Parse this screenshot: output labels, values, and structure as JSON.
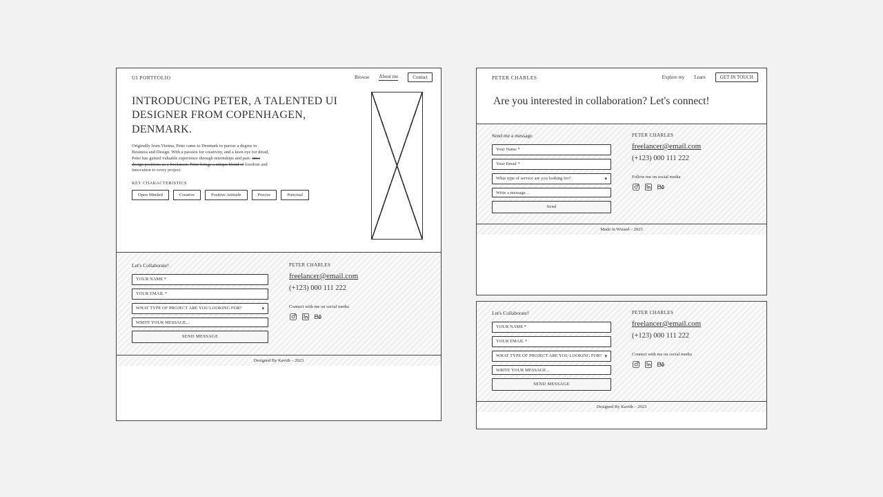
{
  "frameA": {
    "brand": "UI PORTFOLIO",
    "nav": {
      "browse": "Browse",
      "about": "About me",
      "contact_btn": "Contact"
    },
    "hero": {
      "title": "INTRODUCING PETER, A TALENTED UI DESIGNER FROM COPENHAGEN, DENMARK.",
      "para1": "Originally from Vienna, Peter came to Denmark to pursue a degree in Business and Design. With a passion for creativity, and a keen eye for detail, Peter has gained valuable experience through internships and part-",
      "para_strike": "time design positions as a freelancer. Peter brings a unique blend of",
      "para2": "freedom and innovation to every project.",
      "key_label": "KEY CHARACTERISTICS",
      "chips": [
        "Open Minded",
        "Creative",
        "Positive Attitude",
        "Precise",
        "Punctual"
      ]
    },
    "contact": {
      "heading": "Let's Collaborate!",
      "name_ph": "YOUR NAME *",
      "email_ph": "YOUR EMAIL *",
      "select_ph": "WHAT TYPE OF PROJECT ARE YOU LOOKING FOR?",
      "msg_ph": "WRITE YOUR MESSAGE…",
      "send": "SEND MESSAGE",
      "brand": "PETER CHARLES",
      "email": "freelancer@email.com",
      "phone": "(+123) 000 111 222",
      "social_label": "Connect with me on social media"
    },
    "footer": "Designed By Kavith – 2023"
  },
  "frameB": {
    "brand": "PETER CHARLES",
    "nav": {
      "explore": "Explore my",
      "learn": "Learn",
      "btn": "GET IN TOUCH"
    },
    "hero": "Are you interested in collaboration? Let's connect!",
    "contact": {
      "heading": "Send me a message",
      "name_ph": "Your Name *",
      "email_ph": "Your Email *",
      "select_ph": "What type of service are you looking for?",
      "msg_ph": "Write a message…",
      "send": "Send",
      "brand": "PETER CHARLES",
      "email": "freelancer@email.com",
      "phone": "(+123) 000 111 222",
      "social_label": "Follow me on social media"
    },
    "footer": "Made in Wizard – 2023"
  },
  "frameC": {
    "contact": {
      "heading": "Let's Collaborate!",
      "name_ph": "YOUR NAME *",
      "email_ph": "YOUR EMAIL *",
      "select_ph": "WHAT TYPE OF PROJECT ARE YOU LOOKING FOR?",
      "msg_ph": "WRITE YOUR MESSAGE…",
      "send": "SEND MESSAGE",
      "brand": "PETER CHARLES",
      "email": "freelancer@email.com",
      "phone": "(+123) 000 111 222",
      "social_label": "Connect with me on social media"
    },
    "footer": "Designed By Kavith – 2023"
  }
}
